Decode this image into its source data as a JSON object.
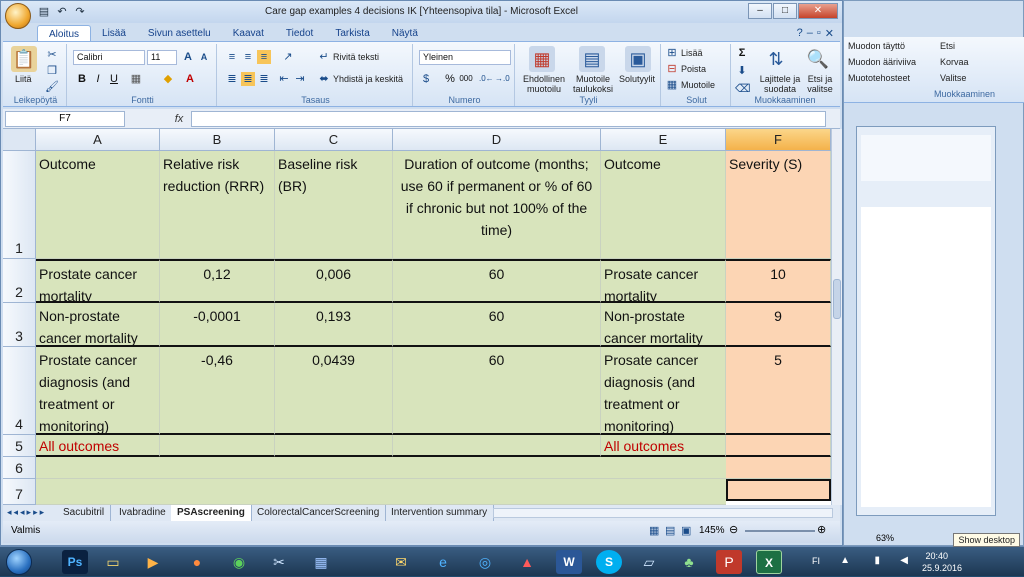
{
  "window": {
    "title": "Care gap examples 4 decisions IK  [Yhteensopiva tila] - Microsoft Excel"
  },
  "tabs": [
    "Aloitus",
    "Lisää",
    "Sivun asettelu",
    "Kaavat",
    "Tiedot",
    "Tarkista",
    "Näytä"
  ],
  "ribbon": {
    "paste": "Liitä",
    "clipboard": "Leikepöytä",
    "font_name": "Calibri",
    "font_size": "11",
    "font_group": "Fontti",
    "wrap": "Rivitä teksti",
    "merge": "Yhdistä ja keskitä",
    "align_group": "Tasaus",
    "number_format": "Yleinen",
    "number_group": "Numero",
    "cond_format": "Ehdollinen muotoilu",
    "format_table": "Muotoile taulukoksi",
    "cell_styles": "Solutyylit",
    "styles_group": "Tyyli",
    "insert": "Lisää",
    "delete": "Poista",
    "format": "Muotoile",
    "cells_group": "Solut",
    "sort": "Lajittele ja suodata",
    "find": "Etsi ja valitse",
    "editing_group": "Muokkaaminen"
  },
  "formula_bar": {
    "name_box": "F7",
    "fx": "fx",
    "content": ""
  },
  "columns": [
    "A",
    "B",
    "C",
    "D",
    "E",
    "F"
  ],
  "rows": [
    {
      "num": "1",
      "a": "Outcome",
      "b": "Relative risk reduction (RRR)",
      "c": "Baseline risk (BR)",
      "d": "Duration of outcome (months; use 60 if permanent or % of 60 if chronic but not 100% of the time)",
      "e": "Outcome",
      "f": "Severity (S)"
    },
    {
      "num": "2",
      "a": "Prostate cancer mortality",
      "b": "0,12",
      "c": "0,006",
      "d": "60",
      "e": "Prosate cancer mortality",
      "f": "10"
    },
    {
      "num": "3",
      "a": "Non-prostate cancer mortality",
      "b": "-0,0001",
      "c": "0,193",
      "d": "60",
      "e": "Non-prostate cancer mortality",
      "f": "9"
    },
    {
      "num": "4",
      "a": "Prostate cancer diagnosis (and treatment or monitoring)",
      "b": "-0,46",
      "c": "0,0439",
      "d": "60",
      "e": "Prosate cancer diagnosis (and treatment or monitoring)",
      "f": "5"
    },
    {
      "num": "5",
      "a": "All outcomes",
      "b": "",
      "c": "",
      "d": "",
      "e": "All outcomes",
      "f": ""
    },
    {
      "num": "6",
      "a": "",
      "b": "",
      "c": "",
      "d": "",
      "e": "",
      "f": ""
    },
    {
      "num": "7",
      "a": "",
      "b": "",
      "c": "",
      "d": "",
      "e": "",
      "f": ""
    }
  ],
  "sheet_tabs": [
    "Sacubitril",
    "Ivabradine",
    "PSAscreening",
    "ColorectalCancerScreening",
    "Intervention summary"
  ],
  "active_sheet": "PSAscreening",
  "status": {
    "ready": "Valmis",
    "zoom": "145%"
  },
  "background_window": {
    "fill": "Muodon täyttö",
    "outline": "Muodon ääriviiva",
    "effects": "Muototehosteet",
    "find": "Etsi",
    "replace": "Korvaa",
    "select": "Valitse",
    "editing": "Muokkaaminen",
    "zoom": "63%"
  },
  "taskbar": {
    "lang": "FI",
    "show_desktop": "Show desktop",
    "time": "20:40",
    "date": "25.9.2016"
  }
}
